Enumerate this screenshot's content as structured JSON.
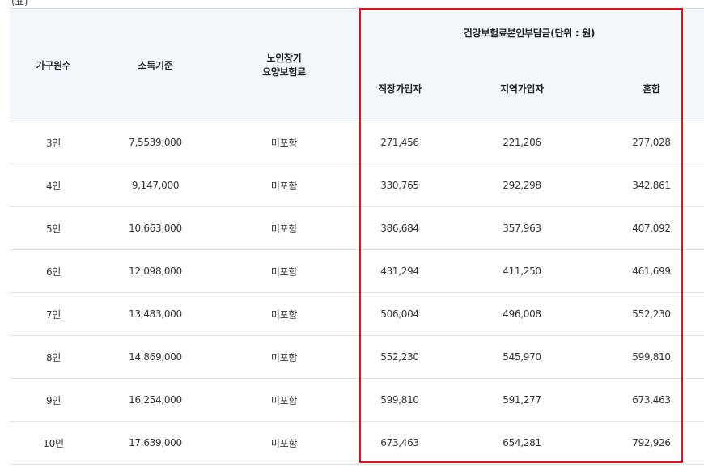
{
  "caption": "(표)",
  "headers": {
    "household": "가구원수",
    "income": "소득기준",
    "ltc_line1": "노인장기",
    "ltc_line2": "요양보험료",
    "group": "건강보험료본인부담금(단위 : 원)",
    "employee": "직장가입자",
    "regional": "지역가입자",
    "mixed": "혼합"
  },
  "rows": [
    {
      "household": "3인",
      "income": "7,5539,000",
      "ltc": "미포함",
      "employee": "271,456",
      "regional": "221,206",
      "mixed": "277,028"
    },
    {
      "household": "4인",
      "income": "9,147,000",
      "ltc": "미포함",
      "employee": "330,765",
      "regional": "292,298",
      "mixed": "342,861"
    },
    {
      "household": "5인",
      "income": "10,663,000",
      "ltc": "미포함",
      "employee": "386,684",
      "regional": "357,963",
      "mixed": "407,092"
    },
    {
      "household": "6인",
      "income": "12,098,000",
      "ltc": "미포함",
      "employee": "431,294",
      "regional": "411,250",
      "mixed": "461,699"
    },
    {
      "household": "7인",
      "income": "13,483,000",
      "ltc": "미포함",
      "employee": "506,004",
      "regional": "496,008",
      "mixed": "552,230"
    },
    {
      "household": "8인",
      "income": "14,869,000",
      "ltc": "미포함",
      "employee": "552,230",
      "regional": "545,970",
      "mixed": "599,810"
    },
    {
      "household": "9인",
      "income": "16,254,000",
      "ltc": "미포함",
      "employee": "599,810",
      "regional": "591,277",
      "mixed": "673,463"
    },
    {
      "household": "10인",
      "income": "17,639,000",
      "ltc": "미포함",
      "employee": "673,463",
      "regional": "654,281",
      "mixed": "792,926"
    }
  ],
  "colors": {
    "highlight": "#e3101e",
    "header_bg": "#f3f6fb"
  }
}
